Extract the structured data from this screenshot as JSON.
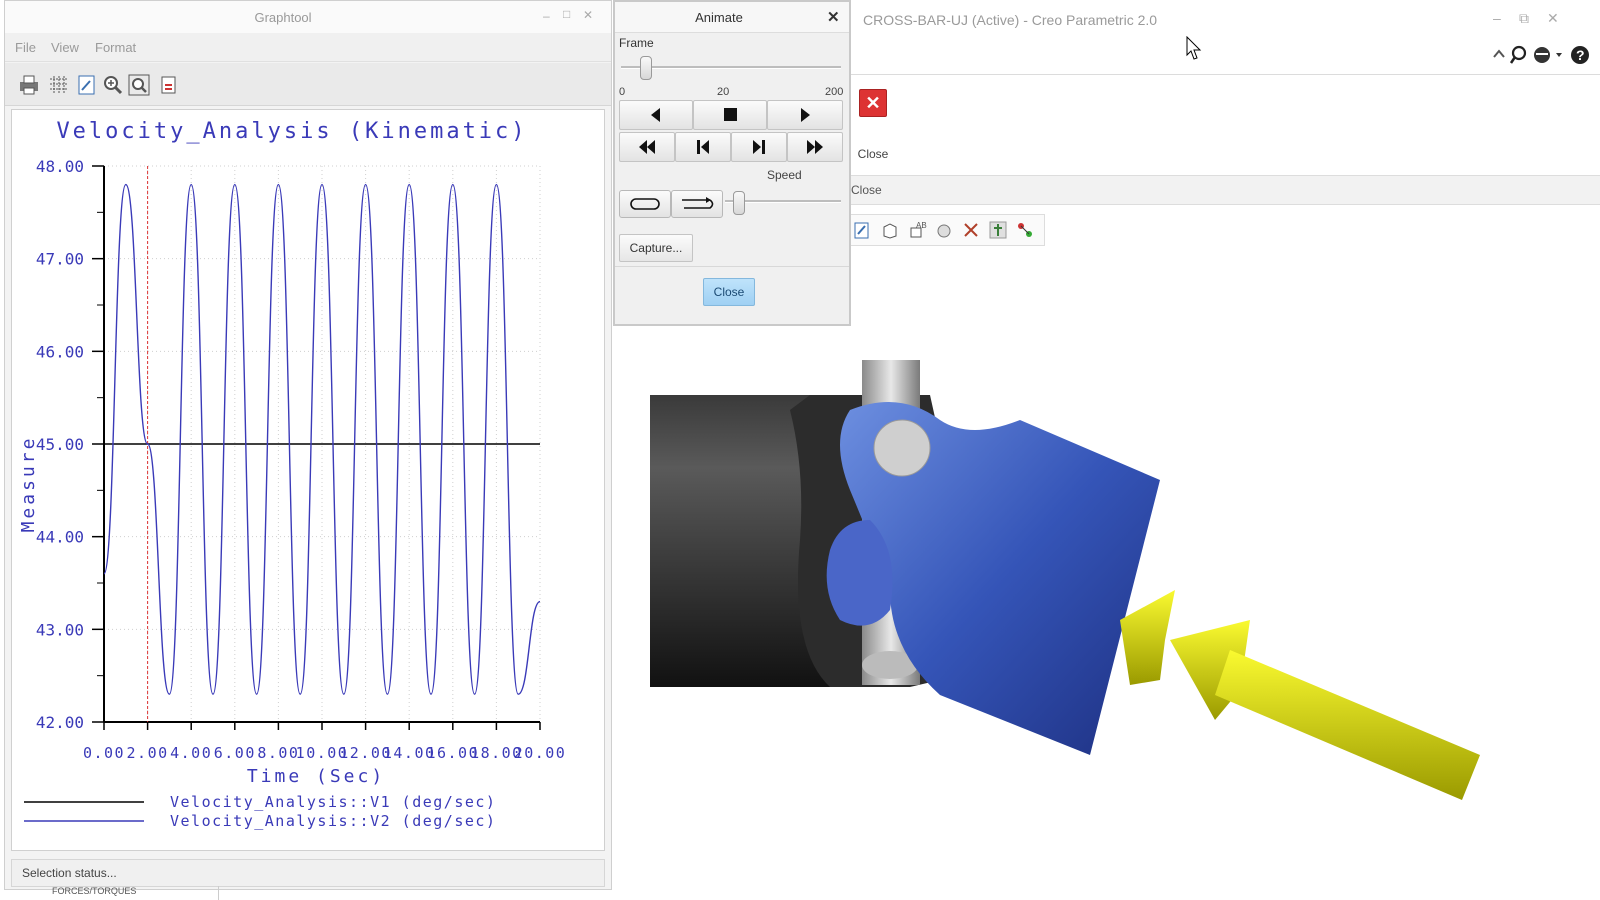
{
  "main_window": {
    "title": "CROSS-BAR-UJ (Active) - Creo Parametric 2.0",
    "ribbon": {
      "close_label": "Close",
      "group_label": "Close"
    }
  },
  "graphtool": {
    "title": "Graphtool",
    "menu": [
      "File",
      "View",
      "Format"
    ],
    "toolbar_icons": [
      "print-icon",
      "grid-icon",
      "edit-icon",
      "zoom-in-icon",
      "refit-icon",
      "export-icon"
    ],
    "status": "Selection status...",
    "bottom_tab": "FORCES/TORQUES"
  },
  "animate": {
    "title": "Animate",
    "frame_label": "Frame",
    "frame_ticks": [
      "0",
      "20",
      "200"
    ],
    "frame_value": 20,
    "speed_label": "Speed",
    "capture_label": "Capture...",
    "close_label": "Close"
  },
  "chart_data": {
    "type": "line",
    "title": "Velocity_Analysis (Kinematic)",
    "xlabel": "Time (Sec)",
    "ylabel": "Measure",
    "xlim": [
      0,
      20
    ],
    "ylim": [
      42,
      48
    ],
    "x_tick_labels": [
      "0.00",
      "2.00",
      "4.00",
      "6.00",
      "8.00",
      "10.00",
      "12.00",
      "14.00",
      "16.00",
      "18.00",
      "20.00"
    ],
    "y_tick_labels": [
      "42.00",
      "43.00",
      "44.00",
      "45.00",
      "46.00",
      "47.00",
      "48.00"
    ],
    "grid": true,
    "cursor_time": 2.0,
    "series": [
      {
        "name": "Velocity_Analysis::V1 (deg/sec)",
        "color": "#000000",
        "x": [
          0,
          20
        ],
        "y": [
          45,
          45
        ]
      },
      {
        "name": "Velocity_Analysis::V2 (deg/sec)",
        "color": "#3a3ab8",
        "x": [
          0,
          1,
          2,
          3,
          4,
          5,
          6,
          7,
          8,
          9,
          10,
          11,
          12,
          13,
          14,
          15,
          16,
          17,
          18,
          19,
          20
        ],
        "y": [
          43.6,
          47.8,
          45.0,
          42.3,
          47.8,
          42.3,
          47.8,
          42.3,
          47.8,
          42.3,
          47.8,
          42.3,
          47.8,
          42.3,
          47.8,
          42.3,
          47.8,
          42.3,
          47.8,
          42.3,
          43.3
        ]
      }
    ],
    "legend_placement": "bottom"
  }
}
